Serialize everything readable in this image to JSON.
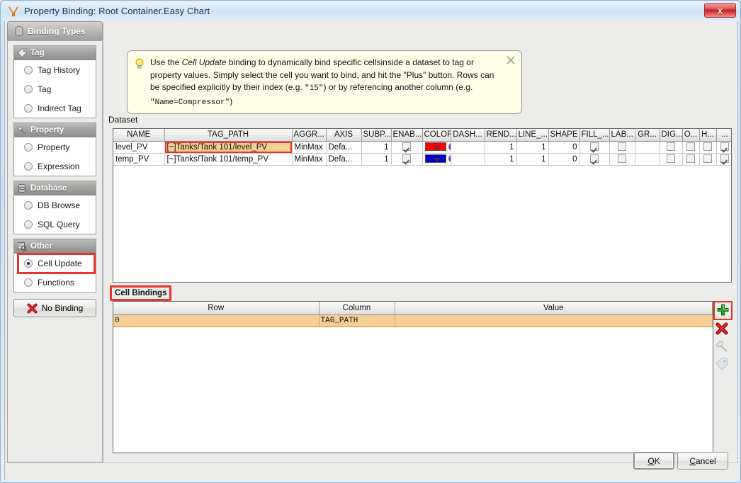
{
  "window": {
    "title": "Property Binding: Root Container.Easy Chart",
    "title_icon": "binding-icon",
    "close_label": "x"
  },
  "sidebar": {
    "tab_label": "Binding Types",
    "tab_icon": "binding-types-icon",
    "groups": [
      {
        "title": "Tag",
        "icon": "tag-icon",
        "items": [
          {
            "label": "Tag History",
            "selected": false
          },
          {
            "label": "Tag",
            "selected": false
          },
          {
            "label": "Indirect Tag",
            "selected": false
          }
        ]
      },
      {
        "title": "Property",
        "icon": "property-icon",
        "items": [
          {
            "label": "Property",
            "selected": false
          },
          {
            "label": "Expression",
            "selected": false
          }
        ]
      },
      {
        "title": "Database",
        "icon": "database-icon",
        "items": [
          {
            "label": "DB Browse",
            "selected": false
          },
          {
            "label": "SQL Query",
            "selected": false
          }
        ]
      },
      {
        "title": "Other",
        "icon": "other-icon",
        "items": [
          {
            "label": "Cell Update",
            "selected": true
          },
          {
            "label": "Functions",
            "selected": false
          }
        ]
      }
    ],
    "no_binding_label": "No Binding",
    "no_binding_icon": "red-x-icon"
  },
  "hint": {
    "icon": "lightbulb-icon",
    "part1": "Use the ",
    "emphasis1": "Cell Update",
    "part2": " binding to dynamically bind specific cellsinside a dataset to tag or property values. Simply select the cell you want to bind, and hit the \"Plus\" button. Rows can be specified explicitly by their index (e.g. ",
    "mono1": "\"15\"",
    "part3": ") or by referencing another column (e.g. ",
    "mono2": "\"Name=Compressor\"",
    "part4": ")",
    "close_icon": "close-icon"
  },
  "dataset": {
    "label": "Dataset",
    "columns": [
      "NAME",
      "TAG_PATH",
      "AGGR...",
      "AXIS",
      "SUBP...",
      "ENAB...",
      "COLOR",
      "DASH...",
      "REND...",
      "LINE_...",
      "SHAPE",
      "FILL_...",
      "LAB...",
      "GR...",
      "DIG...",
      "O...",
      "H...",
      "...",
      "...",
      "..."
    ],
    "rows": [
      {
        "name": "level_PV",
        "tag_path": "[~]Tanks/Tank 101/level_PV",
        "tag_path_highlighted": true,
        "aggr": "MinMax",
        "axis": "Defa...",
        "subp": "1",
        "enab": true,
        "color": "#ff0000",
        "dash": "",
        "rend": "1",
        "line": "1",
        "shape": "0",
        "fill": true,
        "lab": false,
        "gr": "",
        "dig": false,
        "o": false,
        "h": false,
        "x1": true,
        "x2": "",
        "x3": false
      },
      {
        "name": "temp_PV",
        "tag_path": "[~]Tanks/Tank 101/temp_PV",
        "tag_path_highlighted": false,
        "aggr": "MinMax",
        "axis": "Defa...",
        "subp": "1",
        "enab": true,
        "color": "#0000cc",
        "dash": "",
        "rend": "1",
        "line": "1",
        "shape": "0",
        "fill": true,
        "lab": false,
        "gr": "",
        "dig": false,
        "o": false,
        "h": false,
        "x1": true,
        "x2": "",
        "x3": false
      }
    ]
  },
  "cell_bindings": {
    "label": "Cell Bindings",
    "columns": [
      "Row",
      "Column",
      "Value"
    ],
    "rows": [
      {
        "row": "0",
        "column": "TAG_PATH",
        "value": ""
      }
    ],
    "tools": [
      {
        "name": "add-binding-button",
        "icon": "green-plus-icon",
        "highlighted": true
      },
      {
        "name": "delete-binding-button",
        "icon": "red-x-icon",
        "highlighted": false
      },
      {
        "name": "property-binding-button",
        "icon": "property-icon",
        "highlighted": false
      },
      {
        "name": "tag-binding-button",
        "icon": "tag-icon",
        "highlighted": false
      }
    ]
  },
  "footer": {
    "ok_label": "OK",
    "ok_mnemonic": "O",
    "ok_rest": "K",
    "cancel_label": "Cancel",
    "cancel_mnemonic": "C",
    "cancel_rest": "ancel"
  },
  "colors": {
    "accent_red": "#e8342a",
    "highlight_fill": "#f6cf94",
    "titlebar": "#cfe3f6",
    "panel_bg": "#ececea"
  }
}
